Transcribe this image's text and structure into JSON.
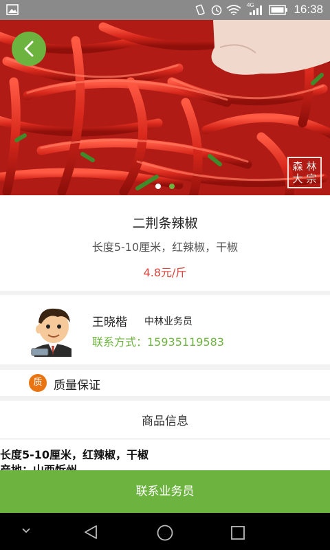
{
  "status_bar": {
    "time": "16:38",
    "signal_label": "4G",
    "colors": {
      "bg": "#8a8a8a"
    },
    "icons": [
      "image-icon",
      "vibrate-icon",
      "alarm-icon",
      "wifi-icon",
      "signal-icon",
      "battery-icon"
    ]
  },
  "hero": {
    "stamp_chars": [
      "森",
      "林",
      "大",
      "宗"
    ],
    "carousel": {
      "count": 2,
      "active_index": 1
    }
  },
  "product": {
    "name": "二荆条辣椒",
    "description": "长度5-10厘米，红辣椒，干椒",
    "price": "4.8元/斤"
  },
  "agent": {
    "name": "王晓楷",
    "role": "中林业务员",
    "contact": "联系方式：15935119583"
  },
  "quality": {
    "badge": "质",
    "label": "质量保证"
  },
  "info": {
    "heading": "商品信息",
    "line1": "长度5-10厘米，红辣椒，干椒",
    "line2": "产地：山西忻州"
  },
  "action": {
    "contact_button": "联系业务员"
  },
  "colors": {
    "accent_green": "#6db33f",
    "price_red": "#d9453e",
    "badge_orange": "#e87512"
  },
  "nav": {
    "icons": [
      "chevron-down-icon",
      "back-icon",
      "home-icon",
      "recents-icon"
    ]
  }
}
